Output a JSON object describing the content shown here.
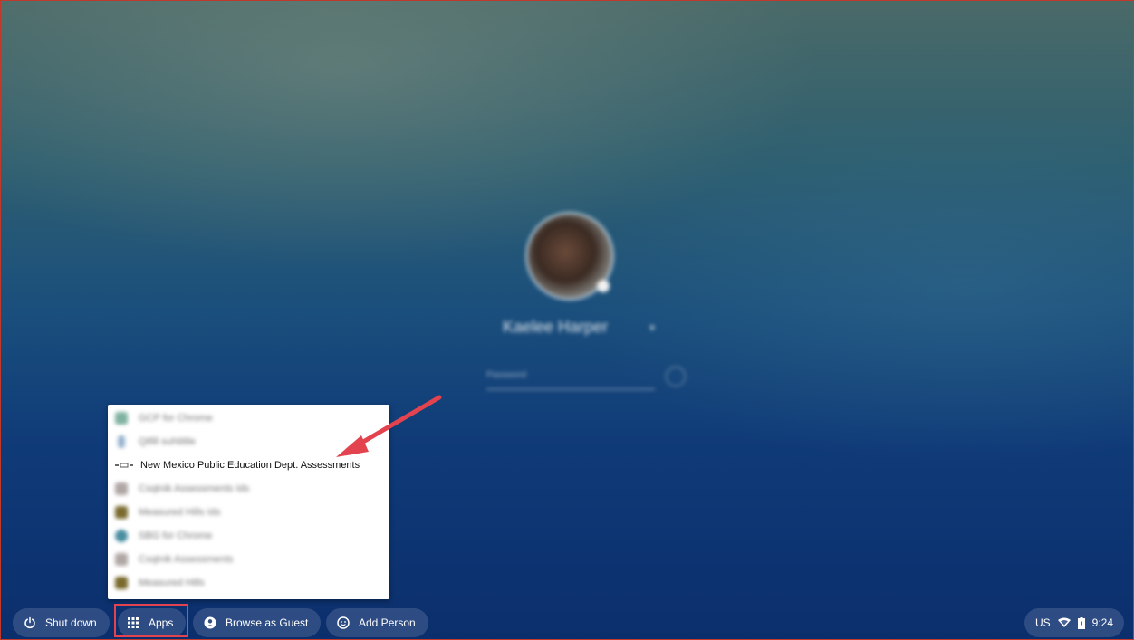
{
  "login": {
    "user_name": "Kaelee Harper",
    "password_placeholder": "Password"
  },
  "apps_menu": {
    "items": [
      {
        "label": "GCP for Chrome",
        "blurred": true,
        "icon_color": "#7fb3a0"
      },
      {
        "label": "Qtfill suhtittle",
        "blurred": true,
        "icon_color": "#9ab4d0"
      },
      {
        "label": "New Mexico Public Education Dept. Assessments",
        "blurred": false,
        "icon_color": "#555555"
      },
      {
        "label": "Csqtnik Assessments Ids",
        "blurred": true,
        "icon_color": "#b0a7a5"
      },
      {
        "label": "Measured Hills Ids",
        "blurred": true,
        "icon_color": "#7a6a2e"
      },
      {
        "label": "SBG for Chrome",
        "blurred": true,
        "icon_color": "#4a8ea0"
      },
      {
        "label": "Csqtnik Assessments",
        "blurred": true,
        "icon_color": "#b0a7a5"
      },
      {
        "label": "Measured Hills",
        "blurred": true,
        "icon_color": "#7a6a2e"
      }
    ]
  },
  "shelf": {
    "shutdown_label": "Shut down",
    "apps_label": "Apps",
    "guest_label": "Browse as Guest",
    "add_person_label": "Add Person"
  },
  "status": {
    "keyboard": "US",
    "time": "9:24"
  },
  "colors": {
    "annotation": "#e2434f"
  }
}
